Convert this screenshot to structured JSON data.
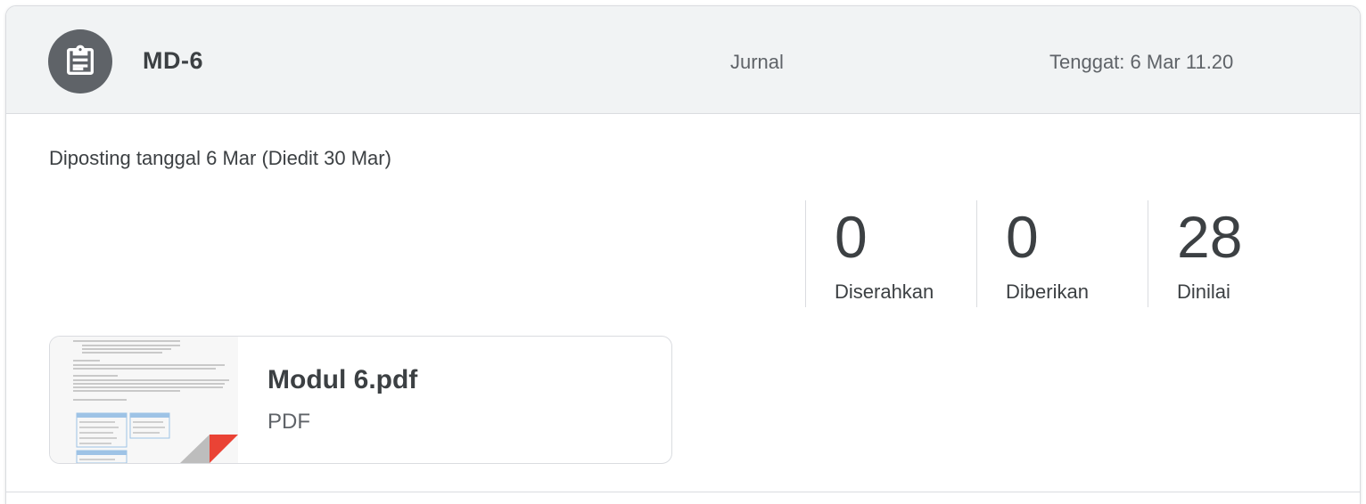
{
  "assignment": {
    "icon": "assignment-icon",
    "title": "MD-6",
    "topic": "Jurnal",
    "due": "Tenggat: 6 Mar 11.20"
  },
  "posted": "Diposting tanggal 6 Mar (Diedit 30 Mar)",
  "stats": [
    {
      "value": "0",
      "label": "Diserahkan"
    },
    {
      "value": "0",
      "label": "Diberikan"
    },
    {
      "value": "28",
      "label": "Dinilai"
    }
  ],
  "attachment": {
    "name": "Modul 6.pdf",
    "type": "PDF",
    "thumbnail_icon": "pdf-thumbnail",
    "pdf_badge_color": "#ea4335"
  },
  "colors": {
    "header_bg": "#f1f3f4",
    "icon_bg": "#5f6368",
    "text_primary": "#3c4043",
    "text_secondary": "#5f6368",
    "border": "#dadce0"
  }
}
